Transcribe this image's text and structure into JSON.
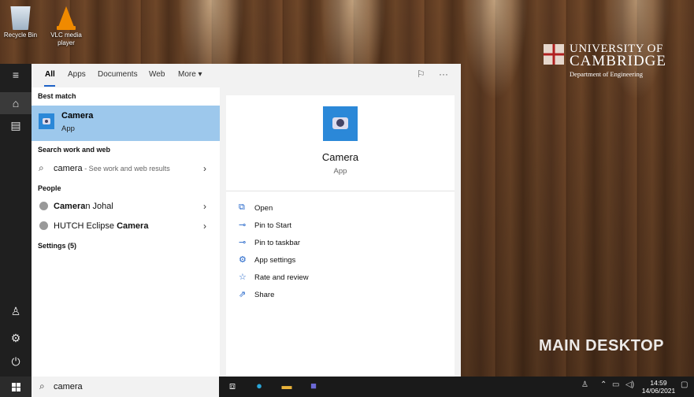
{
  "desktop": {
    "icons": [
      {
        "label": "Recycle Bin",
        "icon": "recycle-bin-icon"
      },
      {
        "label": "VLC media player",
        "icon": "vlc-cone-icon"
      }
    ],
    "logo": {
      "line1": "UNIVERSITY OF",
      "line2": "CAMBRIDGE",
      "line3": "Department of Engineering"
    },
    "watermark": "MAIN DESKTOP"
  },
  "rail": {
    "items": [
      {
        "icon": "hamburger-icon",
        "glyph": "≡"
      },
      {
        "icon": "home-icon",
        "glyph": "⌂"
      },
      {
        "icon": "notebook-icon",
        "glyph": "▤"
      },
      {
        "icon": "person-icon",
        "glyph": "♙"
      },
      {
        "icon": "gear-icon",
        "glyph": "⚙"
      },
      {
        "icon": "power-icon",
        "glyph": "⏻"
      }
    ]
  },
  "search": {
    "tabs": [
      "All",
      "Apps",
      "Documents",
      "Web",
      "More ▾"
    ],
    "active_tab": "All",
    "feedback_icon": "feedback-icon",
    "more_icon": "ellipsis-icon",
    "best_match_header": "Best match",
    "best_match": {
      "title": "Camera",
      "subtitle": "App"
    },
    "web_header": "Search work and web",
    "web_result": {
      "query": "camera",
      "hint": " - See work and web results"
    },
    "people_header": "People",
    "people": [
      {
        "bold": "Camera",
        "rest": "n Johal"
      },
      {
        "pre": "HUTCH Eclipse ",
        "bold": "Camera"
      }
    ],
    "settings_header": "Settings (5)",
    "detail": {
      "title": "Camera",
      "subtitle": "App",
      "actions": [
        {
          "label": "Open",
          "icon": "open-icon",
          "glyph": "⧉"
        },
        {
          "label": "Pin to Start",
          "icon": "pin-icon",
          "glyph": "⊸"
        },
        {
          "label": "Pin to taskbar",
          "icon": "pin-icon",
          "glyph": "⊸"
        },
        {
          "label": "App settings",
          "icon": "gear-icon",
          "glyph": "⚙"
        },
        {
          "label": "Rate and review",
          "icon": "star-list-icon",
          "glyph": "☆"
        },
        {
          "label": "Share",
          "icon": "share-icon",
          "glyph": "⇗"
        }
      ]
    }
  },
  "taskbar": {
    "search_value": "camera",
    "clock_time": "14:59",
    "clock_date": "14/06/2021",
    "accent": "#1e62c8"
  }
}
